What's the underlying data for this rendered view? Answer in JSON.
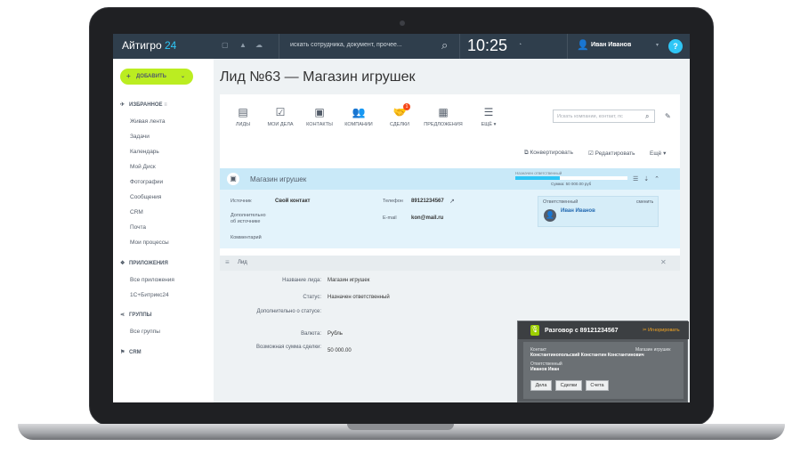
{
  "header": {
    "logo_text": "Айтигро",
    "logo_num": "24",
    "search_placeholder": "искать сотрудника, документ, прочее...",
    "clock": "10:25",
    "user_name": "Иван Иванов",
    "help": "?"
  },
  "sidebar": {
    "add_button": "ДОБАВИТЬ",
    "favorites": "ИЗБРАННОЕ",
    "items": [
      "Живая лента",
      "Задачи",
      "Календарь",
      "Мой Диск",
      "Фотографии",
      "Сообщения",
      "CRM",
      "Почта",
      "Мои процессы"
    ],
    "apps_section": "ПРИЛОЖЕНИЯ",
    "apps_items": [
      "Все приложения",
      "1С+Битрикс24"
    ],
    "groups_section": "ГРУППЫ",
    "groups_items": [
      "Все группы"
    ],
    "crm_section": "CRM"
  },
  "page_title": "Лид №63 — Магазин игрушек",
  "crm_toolbar": {
    "buttons": [
      "ЛИДЫ",
      "МОИ ДЕЛА",
      "КОНТАКТЫ",
      "КОМПАНИИ",
      "СДЕЛКИ",
      "ПРЕДЛОЖЕНИЯ",
      "ЕЩЁ"
    ],
    "deals_badge": "1",
    "search_placeholder": "Искать компании, контакт, пс"
  },
  "actions": {
    "convert": "Конвертировать",
    "edit": "Редактировать",
    "more": "Ещё"
  },
  "lead": {
    "title": "Магазин игрушек",
    "stage_label": "Назначен ответственный",
    "stage_progress": 0.4,
    "sum": "Сумма: 50 000.00 руб",
    "source_label": "Источник",
    "source_value": "Свой контакт",
    "source_more_label_1": "Дополнительно",
    "source_more_label_2": "об источнике",
    "comment_label": "Комментарий",
    "phone_label": "Телефон",
    "phone_value": "89121234567",
    "email_label": "E-mail",
    "email_value": "kon@mail.ru",
    "responsible_label": "Ответственный",
    "change": "сменить",
    "responsible_name": "Иван Иванов"
  },
  "lead_section": {
    "title": "Лид",
    "fields": [
      {
        "label": "Название лида:",
        "value": "Магазин игрушек"
      },
      {
        "label": "Статус:",
        "value": "Назначен ответственный"
      },
      {
        "label": "Дополнительно о статусе:",
        "value": ""
      },
      {
        "label": "Валюта:",
        "value": "Рубль"
      },
      {
        "label": "Возможная сумма сделки:",
        "value": "50 000.00"
      }
    ]
  },
  "call": {
    "title": "Разговор с  89121234567",
    "ignore": "Игнорировать",
    "contact_label": "Контакт",
    "contact_name": "Константинопольский Константин Константинович",
    "responsible_label": "Ответственный",
    "responsible_name": "Иванов Иван",
    "lead_stage": "Магазин игрушек",
    "buttons": [
      "Дела",
      "Сделки",
      "Счета"
    ]
  },
  "colors": {
    "header_bg": "#2f3e4c",
    "accent": "#2fc6f6",
    "add_button": "#bbed21",
    "lead_head": "#c9e9f8"
  }
}
